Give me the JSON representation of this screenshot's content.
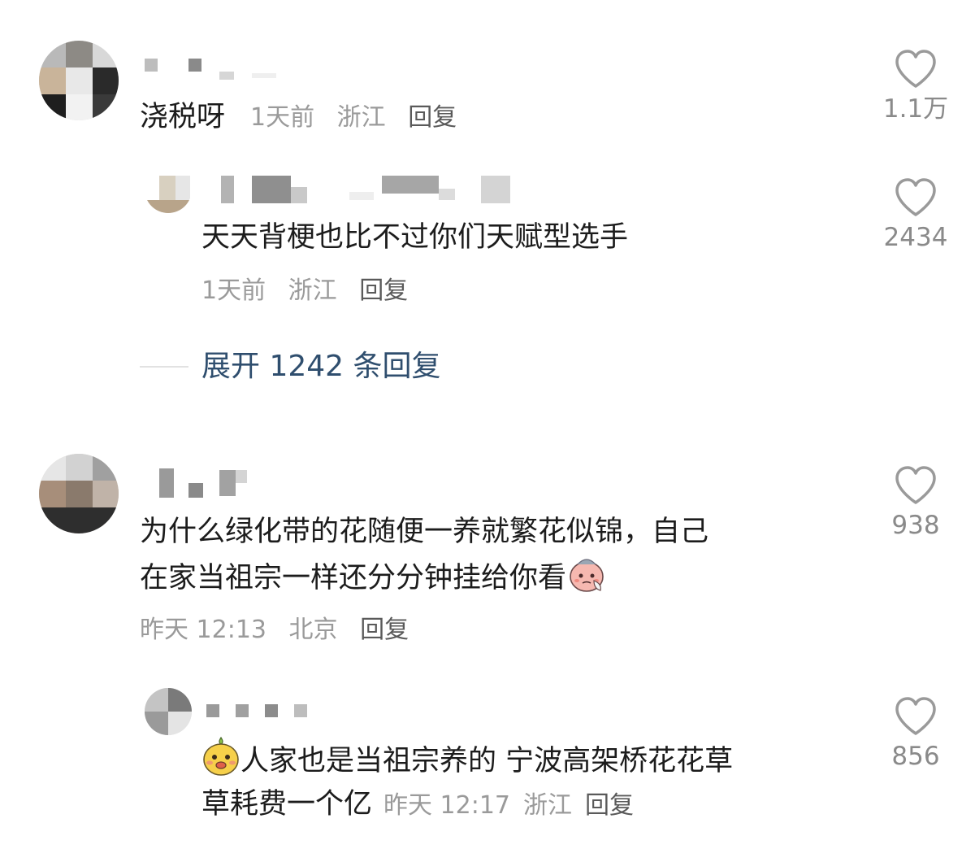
{
  "comments": [
    {
      "text": "浇税呀",
      "time": "1天前",
      "location": "浙江",
      "reply_label": "回复",
      "likes": "1.1万",
      "replies": [
        {
          "text": "天天背梗也比不过你们天赋型选手",
          "time": "1天前",
          "location": "浙江",
          "reply_label": "回复",
          "likes": "2434"
        }
      ],
      "expand_label": "展开 1242 条回复"
    },
    {
      "text_line1": "为什么绿化带的花随便一养就繁花似锦，自己",
      "text_line2": "在家当祖宗一样还分分钟挂给你看",
      "time": "昨天 12:13",
      "location": "北京",
      "reply_label": "回复",
      "likes": "938",
      "emoji": "crying-face-emoji",
      "replies": [
        {
          "text_line1": "人家也是当祖宗养的 宁波高架桥花花草",
          "text_line2": "草耗费一个亿",
          "time": "昨天 12:17",
          "location": "浙江",
          "reply_label": "回复",
          "likes": "856",
          "emoji": "smiling-face-emoji"
        }
      ]
    }
  ],
  "colors": {
    "text": "#1c1c1c",
    "meta": "#9a9a9a",
    "link": "#2f4e6e",
    "icon": "#9a9a9a"
  }
}
